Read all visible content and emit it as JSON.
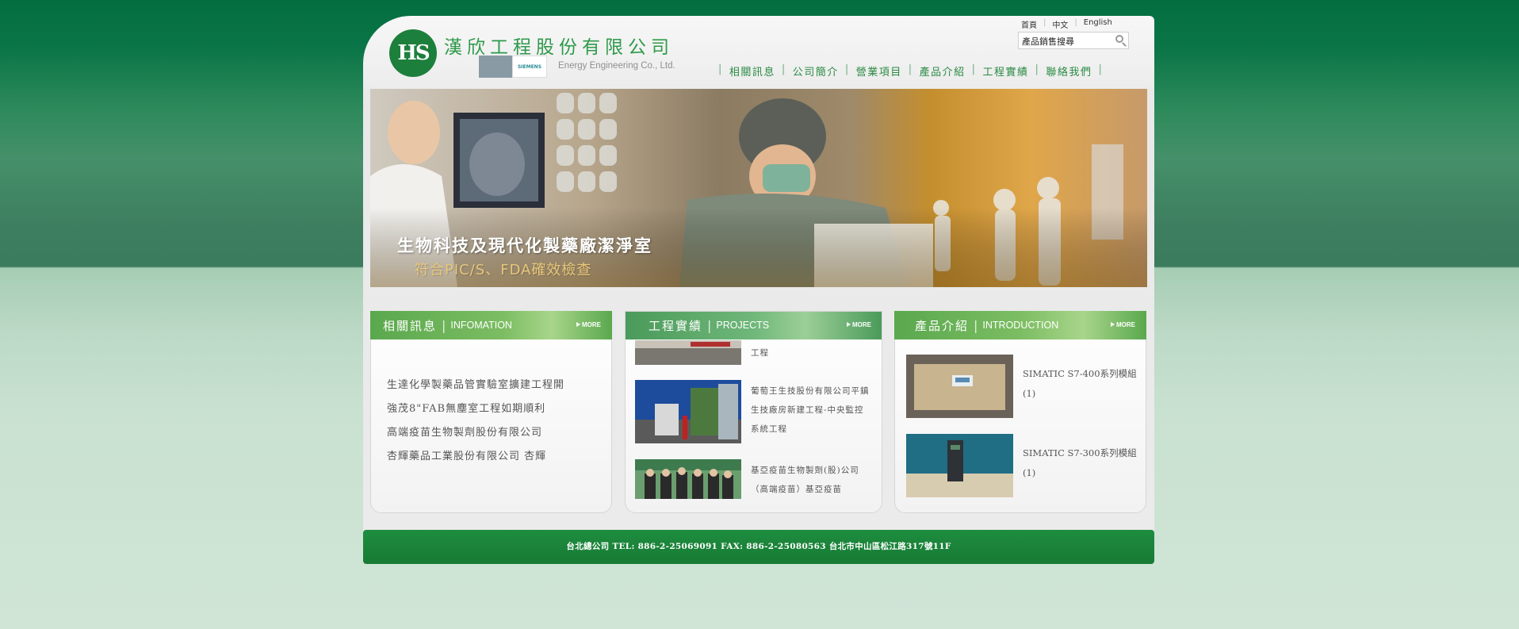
{
  "header": {
    "logo_text": "HS",
    "company_name": "漢欣工程股份有限公司",
    "company_name_en": "Energy Engineering Co., Ltd.",
    "partner_b": "SIEMENS",
    "top_links": [
      {
        "label": "首頁"
      },
      {
        "label": "中文"
      },
      {
        "label": "English"
      }
    ],
    "search": {
      "value": "產品銷售搜尋"
    },
    "nav": [
      {
        "label": "相關訊息"
      },
      {
        "label": "公司簡介"
      },
      {
        "label": "營業項目"
      },
      {
        "label": "產品介紹"
      },
      {
        "label": "工程實績"
      },
      {
        "label": "聯絡我們"
      }
    ],
    "nav_separator": "|"
  },
  "banner": {
    "title": "生物科技及現代化製藥廠潔淨室",
    "subtitle": "符合PIC/S、FDA確效檢查"
  },
  "panels": {
    "info": {
      "title_zh": "相關訊息",
      "title_en": "INFOMATION",
      "more": "MORE",
      "items": [
        "生達化學製藥品管實驗室擴建工程開",
        "強茂8\"FAB無塵室工程如期順利",
        "高端疫苗生物製劑股份有限公司",
        "杏輝藥品工業股份有限公司 杏輝"
      ]
    },
    "projects": {
      "title_zh": "工程實績",
      "title_en": "PROJECTS",
      "more": "MORE",
      "items": [
        {
          "text": "工程"
        },
        {
          "text": "葡萄王生技股份有限公司平鎮生技廠房新建工程-中央監控系統工程"
        },
        {
          "text": "基亞疫苗生物製劑(股)公司（高端疫苗）基亞疫苗"
        }
      ]
    },
    "products": {
      "title_zh": "產品介紹",
      "title_en": "INTRODUCTION",
      "more": "MORE",
      "items": [
        {
          "text": "SIMATIC S7-400系列模組(1)"
        },
        {
          "text": "SIMATIC S7-300系列模組(1)"
        }
      ]
    }
  },
  "footer": {
    "text": "台北總公司 TEL: 886-2-25069091 FAX: 886-2-25080563 台北市中山區松江路317號11F"
  },
  "colors": {
    "brand_green": "#1d7f3c",
    "nav_green": "#2a8b44",
    "footer_green": "#1e8d3f"
  }
}
